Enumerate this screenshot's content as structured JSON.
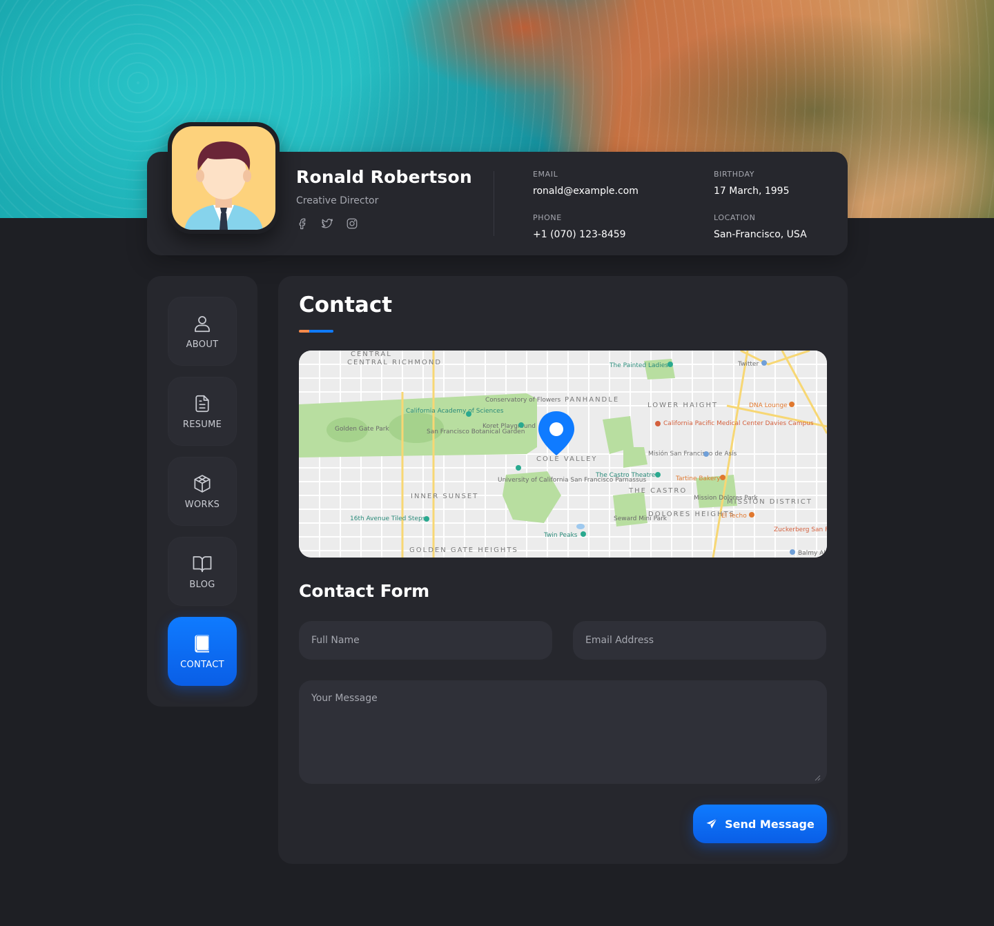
{
  "profile": {
    "name": "Ronald Robertson",
    "role": "Creative Director",
    "email_label": "EMAIL",
    "email": "ronald@example.com",
    "phone_label": "PHONE",
    "phone": "+1 (070) 123-8459",
    "birthday_label": "BIRTHDAY",
    "birthday": "17 March, 1995",
    "location_label": "LOCATION",
    "location": "San-Francisco, USA",
    "socials": [
      "facebook-icon",
      "twitter-icon",
      "instagram-icon"
    ]
  },
  "sidebar": {
    "items": [
      {
        "label": "ABOUT",
        "icon": "user-icon"
      },
      {
        "label": "RESUME",
        "icon": "document-icon"
      },
      {
        "label": "WORKS",
        "icon": "box-icon"
      },
      {
        "label": "BLOG",
        "icon": "book-open-icon"
      },
      {
        "label": "CONTACT",
        "icon": "book-icon",
        "active": true
      }
    ]
  },
  "main": {
    "title": "Contact",
    "map": {
      "neighborhoods": [
        "CENTRAL RICHMOND",
        "PANHANDLE",
        "LOWER HAIGHT",
        "COLE VALLEY",
        "INNER SUNSET",
        "THE CASTRO",
        "MISSION DISTRICT",
        "DOLORES HEIGHTS",
        "GOLDEN GATE HEIGHTS"
      ],
      "places": [
        "Golden Gate Park",
        "California Academy of Sciences",
        "Conservatory of Flowers",
        "San Francisco Botanical Garden",
        "Koret Playground",
        "The Painted Ladies",
        "Twitter",
        "DNA Lounge",
        "California Pacific Medical Center Davies Campus",
        "Misión San Francisco de Asís",
        "The Castro Theatre",
        "Tartine Bakery",
        "Mission Dolores Park",
        "El Techo",
        "University of California San Francisco Parnassus",
        "16th Avenue Tiled Steps",
        "Seward Mini Park",
        "Twin Peaks",
        "Zuckerberg San Francisco General",
        "Balmy Alley"
      ]
    },
    "form_title": "Contact Form",
    "form": {
      "name_placeholder": "Full Name",
      "email_placeholder": "Email Address",
      "message_placeholder": "Your Message",
      "send_label": "Send Message"
    }
  },
  "colors": {
    "background": "#1e1f24",
    "card": "#26272d",
    "field": "#2f3038",
    "accent": "#0f7bff",
    "accent_orange": "#f58a4b",
    "avatar_bg": "#fdd27c"
  }
}
